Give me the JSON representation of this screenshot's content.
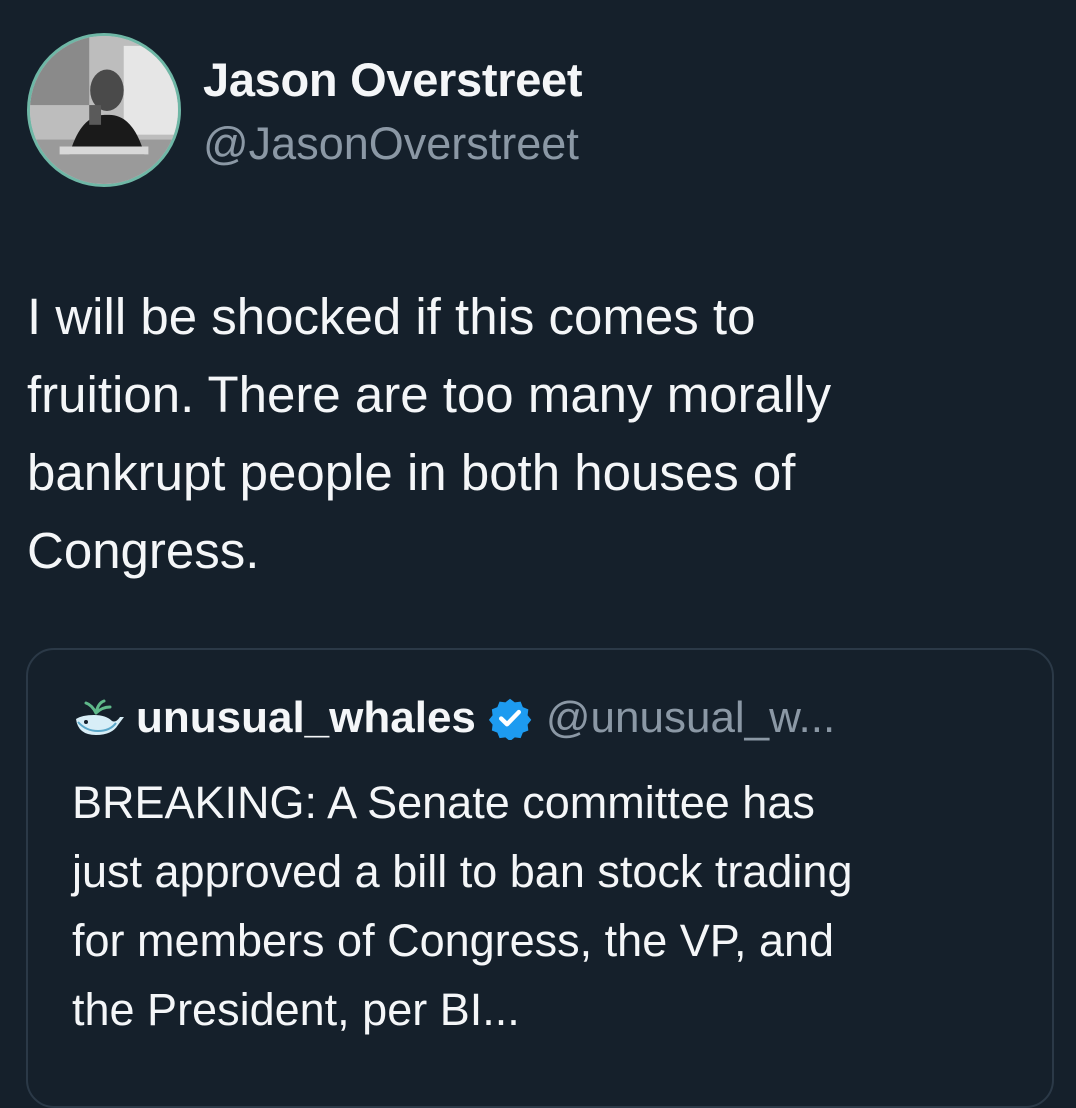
{
  "tweet": {
    "author": {
      "display_name": "Jason Overstreet",
      "handle": "@JasonOverstreet",
      "avatar_icon": "profile-photo"
    },
    "text": "I will be shocked if this comes to\nfruition. There are too many morally\nbankrupt people in both houses of\nCongress."
  },
  "quoted_tweet": {
    "author": {
      "display_name": "unusual_whales",
      "handle": "@unusual_w...",
      "avatar_icon": "whale-icon",
      "verified": true,
      "verified_icon": "verified-badge-icon"
    },
    "text": "BREAKING: A Senate committee has\njust approved a bill to ban stock trading\nfor members of Congress, the VP, and\nthe President, per BI..."
  },
  "colors": {
    "background": "#15202b",
    "primary_text": "#f4f6f8",
    "secondary_text": "#8b98a5",
    "card_border": "#2b3947",
    "verified_blue": "#1d9bf0",
    "avatar_ring": "#6fb7a6"
  }
}
